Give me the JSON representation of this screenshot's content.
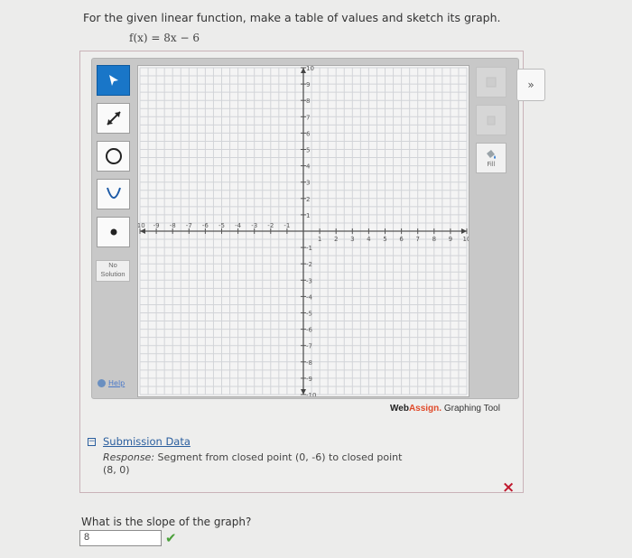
{
  "question": {
    "prompt": "For the given linear function, make a table of values and sketch its graph.",
    "function": "f(x) = 8x − 6"
  },
  "tools": {
    "items": [
      {
        "name": "pointer-tool",
        "icon": "arrow-cursor-icon"
      },
      {
        "name": "line-tool",
        "icon": "line-segment-icon"
      },
      {
        "name": "circle-tool",
        "icon": "circle-icon"
      },
      {
        "name": "parabola-tool",
        "icon": "parabola-icon"
      },
      {
        "name": "point-tool",
        "icon": "point-icon"
      }
    ],
    "no_solution_line1": "No",
    "no_solution_line2": "Solution",
    "help_label": "Help",
    "fill_label": "Fill",
    "expand_label": "»"
  },
  "graph": {
    "x_range": [
      -10,
      10
    ],
    "y_range": [
      -10,
      10
    ],
    "x_ticks": [
      "-10",
      "-9",
      "-8",
      "-7",
      "-6",
      "-5",
      "-4",
      "-3",
      "-2",
      "-1",
      "1",
      "2",
      "3",
      "4",
      "5",
      "6",
      "7",
      "8",
      "9",
      "10"
    ],
    "y_ticks": [
      "10",
      "9",
      "8",
      "7",
      "6",
      "5",
      "4",
      "3",
      "2",
      "1",
      "-1",
      "-2",
      "-3",
      "-4",
      "-5",
      "-6",
      "-7",
      "-8",
      "-9",
      "-10"
    ]
  },
  "brand": {
    "web": "Web",
    "assign": "Assign.",
    "suffix": " Graphing Tool"
  },
  "submission": {
    "toggle": "−",
    "title": "Submission Data",
    "response_label": "Response:",
    "response_text": " Segment from closed point (0, -6) to closed point",
    "response_text2": "(8, 0)",
    "status_icon": "×"
  },
  "slope": {
    "question": "What is the slope of the graph?",
    "answer": "8",
    "status_icon": "✔"
  },
  "colors": {
    "selected_tool": "#1976c8",
    "incorrect": "#c0192e",
    "correct": "#4aa03a",
    "link": "#2a5e9e"
  }
}
